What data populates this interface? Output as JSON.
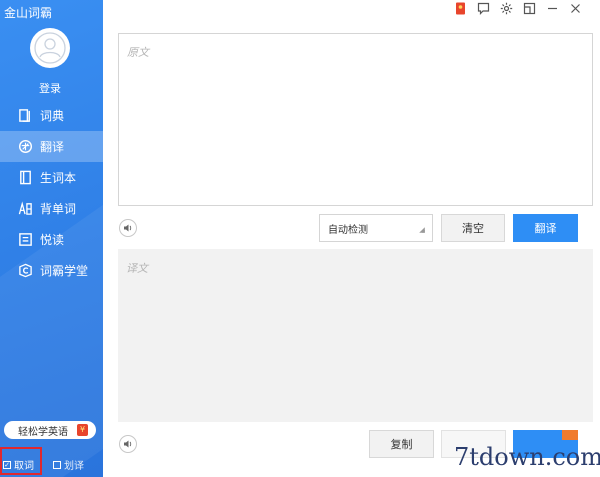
{
  "app": {
    "title": "金山词霸"
  },
  "user": {
    "login_label": "登录"
  },
  "nav": {
    "items": [
      {
        "label": "词典",
        "icon": "dictionary-icon",
        "active": false
      },
      {
        "label": "翻译",
        "icon": "translate-icon",
        "active": true
      },
      {
        "label": "生词本",
        "icon": "wordbook-icon",
        "active": false
      },
      {
        "label": "背单词",
        "icon": "memorize-icon",
        "active": false
      },
      {
        "label": "悦读",
        "icon": "reading-icon",
        "active": false
      },
      {
        "label": "词霸学堂",
        "icon": "academy-icon",
        "active": false
      }
    ]
  },
  "promo": {
    "label": "轻松学英语",
    "badge": "¥"
  },
  "bottom": {
    "cancel_label": "取词",
    "select_label": "划译"
  },
  "source": {
    "placeholder": "原文"
  },
  "language": {
    "selected": "自动检测"
  },
  "buttons": {
    "clear": "清空",
    "translate": "翻译",
    "copy": "复制"
  },
  "target": {
    "placeholder": "译文"
  },
  "watermark": "7tdown.com",
  "colors": {
    "sidebar": "#2f7fe6",
    "primary_button": "#2e8ef5",
    "highlight": "#e0282e"
  }
}
